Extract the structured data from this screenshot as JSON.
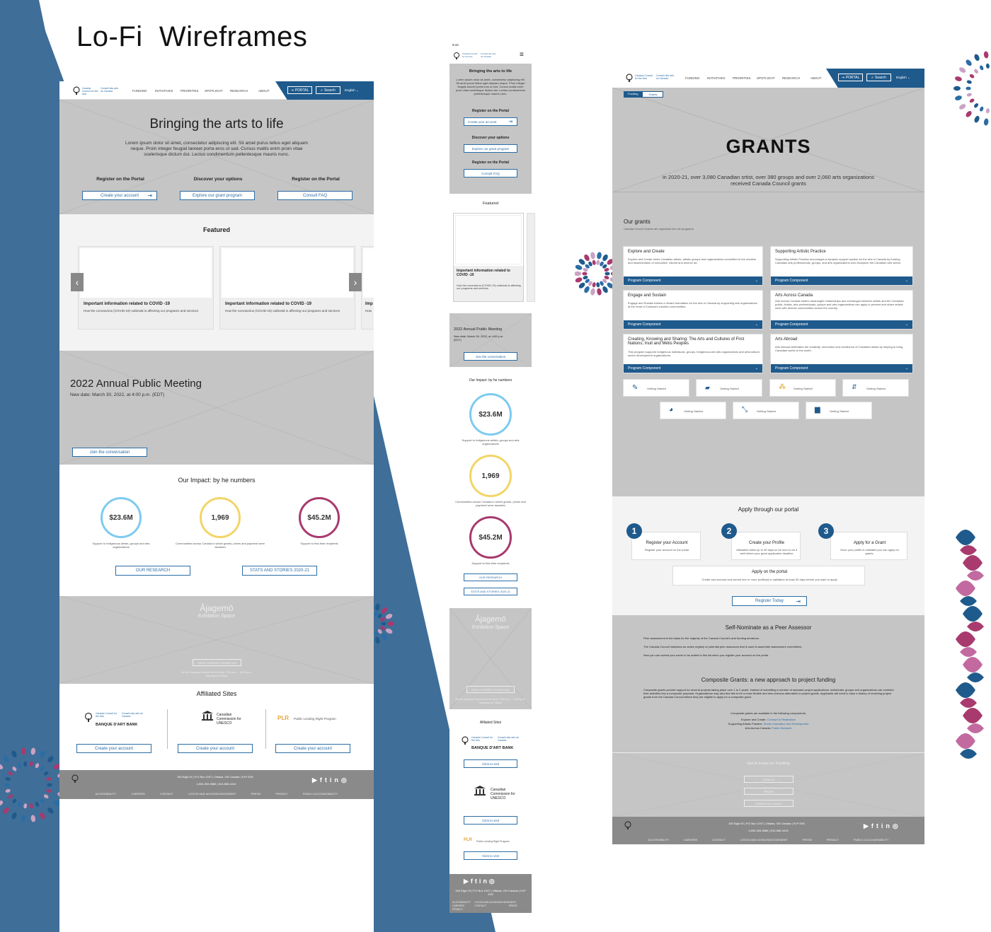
{
  "title": "Lo-Fi  Wireframes",
  "colors": {
    "bg_blue": "#3f6e98",
    "accent_blue": "#1f5a8c",
    "stat1": "#7ecbef",
    "stat2": "#f3d567",
    "stat3": "#a83a6e"
  },
  "desktop": {
    "logo_en": "Canada Council for the Arts",
    "logo_fr": "Conseil des arts du Canada",
    "nav": [
      "FUNDING",
      "INITIATIVES",
      "PRIORITIES",
      "SPOTLIGHT",
      "RESEARCH",
      "ABOUT"
    ],
    "portal": "PORTAL",
    "search": "Search",
    "lang": "English",
    "hero_title": "Bringing the arts to life",
    "hero_text": "Lorem ipsum dolor sit amet, consectetur adipiscing elit. Sit amet purus tellus eget aliquam neque. Proin integer feugiat laoreet porta eros ut sed. Cursus mattis enim proin vitae scelerisque dictum dui. Lectus condimentum pellentesque mauris nunc.",
    "cta": [
      {
        "heading": "Register on the Portal",
        "button": "Create your account"
      },
      {
        "heading": "Discover your options",
        "button": "Explore our grant program"
      },
      {
        "heading": "Register on the Portal",
        "button": "Consult FAQ"
      }
    ],
    "featured_title": "Featured",
    "featured_cards": [
      {
        "title": "Important information related to COVID -19",
        "text": "How the coronavirus (COVID-19) outbreak is affecting our programs and services"
      },
      {
        "title": "Important information related to COVID -19",
        "text": "How the coronavirus (COVID-19) outbreak is affecting our programs and services"
      },
      {
        "title": "Imp",
        "text": "How"
      }
    ],
    "meeting_title": "2022 Annual Public Meeting",
    "meeting_date": "New date: March 30, 2022, at 4:00 p.m. (EDT)",
    "meeting_button": "Join the conversation",
    "impact_title": "Our Impact: by he numbers",
    "stats": [
      {
        "value": "$23.6M",
        "caption": "Support to Indigenous artists, groups and arts organizations"
      },
      {
        "value": "1,969",
        "caption": "Communities across Canada in which grants, prizes and payment were awarded"
      },
      {
        "value": "$45.2M",
        "caption": "Support to first-time recipients"
      }
    ],
    "research_button": "OUR RESEARCH",
    "stories_button": "STATS AND STORIES 2020-21",
    "expo_title": "Âjagemô",
    "expo_sub": "Exhibition Space",
    "expo_button": "VIEW CURRENT EXHIBITION",
    "expo_info": "At the Canada Council for the Arts 7:00 a.m. – 6:00 p.m. Monday to Friday",
    "affiliated_title": "Affiliated Sites",
    "bank": "BANQUE D'ART BANK",
    "unesco": "Canadian Commission for UNESCO",
    "plr": "PLR",
    "plr_text": "Public Lending Right Program",
    "affiliated_button": "Create your account",
    "footer_address": "150 Elgin St | P.O Box 1047 | Ottawa, ON Canada | K1P 5V8",
    "footer_phone": "1-800-263-5588 | 613-566-4414",
    "footer_links": [
      "ACCESSIBILITY",
      "CAREERS",
      "CONTACT",
      "LOGOS AND ACKNOWLEDGEMENT",
      "PRESS",
      "PRIVACY",
      "PUBLIC ACCOUNTABILITY"
    ]
  },
  "mobile": {
    "time": "9:44",
    "hero_title": "Bringing the arts to life",
    "hero_text": "Lorem ipsum dolor sit amet, consectetur adipiscing elit. Sit amet purus tellus eget aliquam neque. Proin integer feugiat laoreet porta eros ut sed. Cursus mattis enim proin vitae scelerisque dictum dui. Lectus condimentum pellentesque mauris nunc.",
    "cta": [
      {
        "heading": "Register on the Portal",
        "button": "Create your account"
      },
      {
        "heading": "Discover your options",
        "button": "Explore our grant program"
      },
      {
        "heading": "Register on the Portal",
        "button": "Consult FAQ"
      }
    ],
    "featured_title": "Featured",
    "card_title": "Important information related to COVID -19",
    "card_text": "How the coronavirus (COVID-19) outbreak is affecting our programs and services",
    "meeting_title": "2022 Annual Public Meeting",
    "meeting_date": "New date: March 30, 2022, at 4:00 p.m. (EDT)",
    "meeting_button": "Join the conversation",
    "impact_title": "Our Impact: by he numbers",
    "expo_title": "Âjagemô",
    "expo_sub": "Exhibition Space",
    "expo_button": "VIEW CURRENT EXHIBITION",
    "expo_info": "At the Canada Council for the Arts 7:00 a.m. – 6:00 p.m. Monday to Friday",
    "affiliated_title": "Afiliated Sites",
    "visit_button": "Click to visit",
    "footer_address": "150 Elgin St | P.O Box 1047 | Ottawa, ON Canada | K1P 5V8",
    "footer_links": [
      "ACCESSIBILITY",
      "LOGOS AND ACKNOWLEDGEMENT",
      "CAREERS",
      "CONTACT",
      "PRESS",
      "PRIVACY"
    ]
  },
  "grants": {
    "breadcrumb": [
      "Funding",
      "Grants"
    ],
    "hero_title": "GRANTS",
    "hero_text": "in 2020-21, over 3,080 Canadian srtist, over 380 groups and over 2,060 arts organizations received Canada Council grants",
    "our_title": "Our grants",
    "our_sub": "Canada Council Grants are organized into six programs.",
    "program_label": "Program Component",
    "programs": [
      {
        "title": "Explore and Create",
        "text": "Explore and Create funds Canadian artists, artistic groups and organizations committed to the creation and dissemination of innovative, vibrant and diverse art."
      },
      {
        "title": "Supporting Artistic Practice",
        "text": "Supporting Artistic Practice encourages a dynamic support system for the arts in Canada by funding Canadian arts professionals, groups, and arts organizations who champion the Canadian arts sector."
      },
      {
        "title": "Engage and Sustain",
        "text": "Engage and Sustain fosters a vibrant foundation for the arts in Canada by supporting arts organizations at the heart of Canada's creative communities."
      },
      {
        "title": "Arts Across Canada",
        "text": "Arts Across Canada fosters meaningful relationships and exchanges between artists and the Canadian public. Artists, arts professionals, groups and arts organizations can apply to present and share artistic work with diverse communities across the country."
      },
      {
        "title": "Creating, Knowing and Sharing: The Arts and Cultures of First Nations, Inuit and Métis Peoples",
        "text": "This program supports Indigenous individuals, groups, Indigenous-led arts organizations and arts/cultural sector development organizations."
      },
      {
        "title": "Arts Abroad",
        "text": "Arts Abroad celebrates the creativity, innovation and excellence of Canadian artists by helping to bring Canadian works to the world."
      }
    ],
    "tile_label": "Getting Started",
    "apply_title": "Apply through our portal",
    "steps": [
      {
        "num": "1",
        "title": "Register your Account",
        "text": "Register your account on the portal"
      },
      {
        "num": "2",
        "title": "Create your Profile",
        "text": "Validation takes up to 30 days so be sure to do it well before your grant application deadline"
      },
      {
        "num": "3",
        "title": "Apply for a Grant",
        "text": "Once your profile is validated you can apply for grants."
      }
    ],
    "portal_title": "Apply on the portal",
    "portal_text": "Create and account and submit one or more profile(s) to validation at least 30 days before you want to apply",
    "register_button": "Register Today",
    "peer_title": "Self-Nominate as a Peer Assessor",
    "peer_lines": [
      "Peer assessment is the basis for the majority of the Canada Council's arts funding decisions.",
      "The Canada Council maintains an active registry of potential peer assessors that is used to assemble assessment committees.",
      "Now you can submit your name to be added to this list when you register your account on the portal."
    ],
    "comp_title": "Composite Grants: a new approach to project funding",
    "comp_text": "Composite grants provide support for several projects taking place over 1 to 2 years. Instead of submitting a number of separate project applications, individuals, groups and organizations can combine their activities into a composite proposal. Organizations may also find this to be a more flexible and less onerous alternative to project grants. Applicants will need to have a history of receiving project grants from the Canada Council before they are eligible to apply for a composite grant.",
    "comp_avail": "Composite grants are available in the following components:",
    "comp_items": [
      {
        "prefix": "Explore and Create: ",
        "link": "Concept to Realization"
      },
      {
        "prefix": "Supporting Artistic Practice: ",
        "link": "Sector Innovation and Development"
      },
      {
        "prefix": "Arts Across Canada: ",
        "link": "Public Outreach"
      }
    ],
    "know_title": "Get to know our Funding",
    "know_buttons": [
      "GRANTS",
      "PRIZES",
      "STRATEGIC FUNDS"
    ]
  }
}
